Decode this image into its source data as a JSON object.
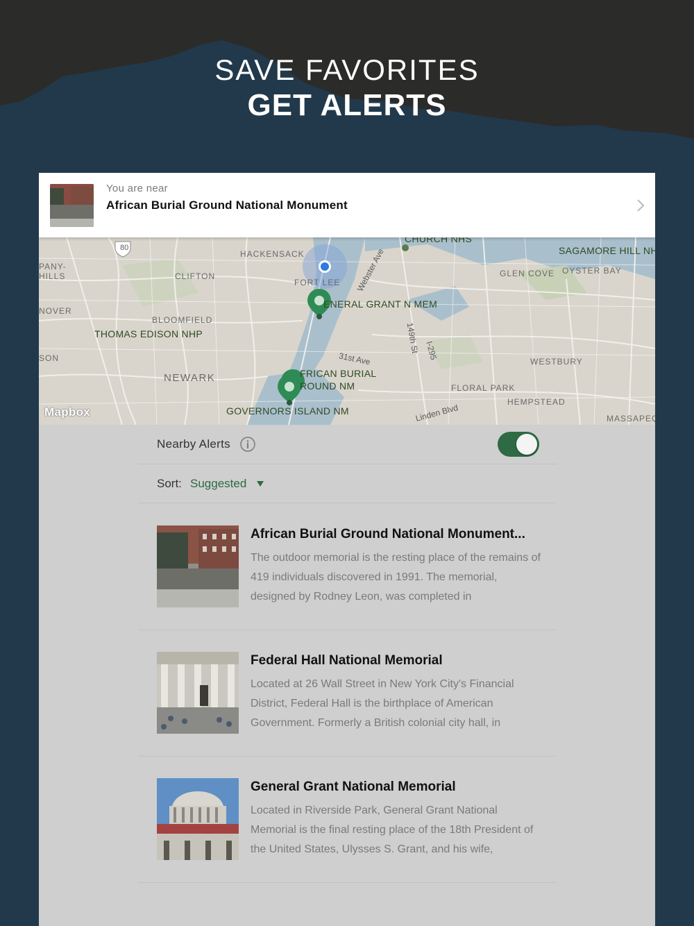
{
  "header": {
    "line1": "SAVE FAVORITES",
    "line2": "GET ALERTS"
  },
  "near": {
    "subtitle": "You are near",
    "title": "African Burial Ground National Monument"
  },
  "map": {
    "attribution": "Mapbox",
    "places": [
      "HACKENSACK",
      "CLIFTON",
      "FORT LEE",
      "BLOOMFIELD",
      "NEWARK",
      "GLEN COVE",
      "OYSTER BAY",
      "WESTBURY",
      "FLORAL PARK",
      "HEMPSTEAD",
      "MASSAPEQ",
      "PANY-",
      "HILLS",
      "NOVER",
      "SON"
    ],
    "parks": [
      "CHURCH NHS",
      "SAGAMORE HILL NH",
      "ENERAL GRANT N MEM",
      "THOMAS EDISON NHP",
      "FRICAN BURIAL",
      "ROUND NM",
      "GOVERNORS ISLAND NM"
    ],
    "roads": [
      "Webster Ave",
      "31st Ave",
      "149th St",
      "I-295",
      "Linden Blvd",
      "80"
    ]
  },
  "alerts": {
    "label": "Nearby Alerts",
    "enabled": true
  },
  "sort": {
    "label": "Sort:",
    "value": "Suggested"
  },
  "items": [
    {
      "title": "African Burial Ground National Monument...",
      "desc": "The outdoor memorial is the resting place of the remains of 419 individuals discovered in 1991. The memorial, designed by Rodney Leon, was completed in"
    },
    {
      "title": "Federal Hall National Memorial",
      "desc": "Located at 26 Wall Street in New York City's Financial District, Federal Hall is the birthplace of American Government. Formerly a British colonial city hall, in"
    },
    {
      "title": "General Grant National Memorial",
      "desc": "Located in Riverside Park, General Grant National Memorial is the final resting place of the 18th President of the United States, Ulysses S. Grant, and his wife,"
    }
  ],
  "colors": {
    "accent": "#2e6a44",
    "background": "#22394b",
    "mountain": "#2b2b2a"
  }
}
